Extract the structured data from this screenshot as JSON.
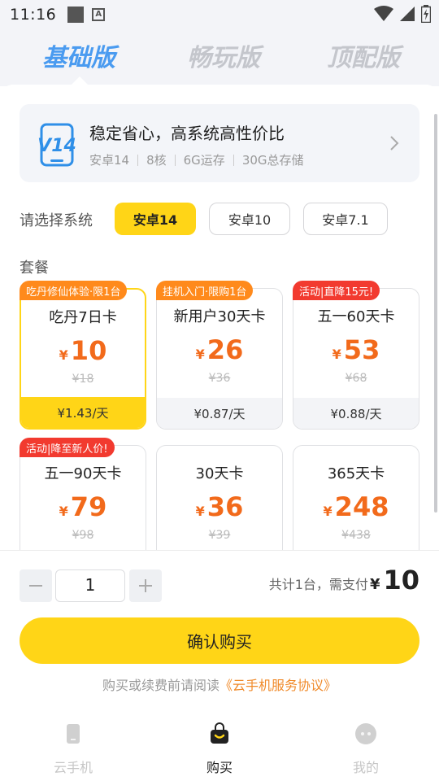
{
  "status_bar": {
    "time": "11:16",
    "notif_letter": "A"
  },
  "tabs": [
    {
      "label": "基础版"
    },
    {
      "label": "畅玩版"
    },
    {
      "label": "顶配版"
    }
  ],
  "system_card": {
    "badge": "V14",
    "title": "稳定省心，高系统高性价比",
    "specs": [
      "安卓14",
      "8核",
      "6G运存",
      "30G总存储"
    ]
  },
  "os_select": {
    "label": "请选择系统",
    "options": [
      "安卓14",
      "安卓10",
      "安卓7.1"
    ],
    "selected": "安卓14"
  },
  "packages_label": "套餐",
  "packages": [
    {
      "badge": "吃丹修仙体验·限1台",
      "badge_color": "#ff8a1c",
      "name": "吃丹7日卡",
      "currency": "¥",
      "price": "10",
      "orig": "¥18",
      "daily": "¥1.43/天",
      "selected": true
    },
    {
      "badge": "挂机入门·限购1台",
      "badge_color": "#ff8a1c",
      "name": "新用户30天卡",
      "currency": "¥",
      "price": "26",
      "orig": "¥36",
      "daily": "¥0.87/天"
    },
    {
      "badge": "活动|直降15元!",
      "badge_color": "#f23a2f",
      "name": "五一60天卡",
      "currency": "¥",
      "price": "53",
      "orig": "¥68",
      "daily": "¥0.88/天"
    },
    {
      "badge": "活动|降至新人价!",
      "badge_color": "#f23a2f",
      "name": "五一90天卡",
      "currency": "¥",
      "price": "79",
      "orig": "¥98"
    },
    {
      "name": "30天卡",
      "currency": "¥",
      "price": "36",
      "orig": "¥39"
    },
    {
      "name": "365天卡",
      "currency": "¥",
      "price": "248",
      "orig": "¥438"
    }
  ],
  "quantity": {
    "value": "1"
  },
  "total": {
    "label": "共计1台，需支付",
    "currency": "¥",
    "amount": "10"
  },
  "confirm_button": "确认购买",
  "agreement": {
    "prefix": "购买或续费前请阅读",
    "link": "《云手机服务协议》"
  },
  "bottom_nav": [
    {
      "label": "云手机",
      "icon": "phone-icon"
    },
    {
      "label": "购买",
      "icon": "shopping-bag-icon",
      "active": true
    },
    {
      "label": "我的",
      "icon": "profile-icon"
    }
  ],
  "colors": {
    "accent": "#ffd517",
    "price": "#f26a1b",
    "active_tab": "#4a9bf0"
  }
}
